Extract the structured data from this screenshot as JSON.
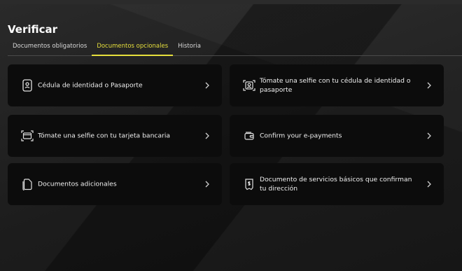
{
  "page": {
    "title": "Verificar"
  },
  "tabs": [
    {
      "label": "Documentos obligatorios",
      "active": false
    },
    {
      "label": "Documentos opcionales",
      "active": true
    },
    {
      "label": "Historia",
      "active": false
    }
  ],
  "cards": [
    {
      "label": "Cédula de identidad o Pasaporte",
      "icon": "id-card-icon"
    },
    {
      "label": "Tómate una selfie con tu cédula de identidad o pasaporte",
      "icon": "selfie-id-icon"
    },
    {
      "label": "Tómate una selfie con tu tarjeta bancaria",
      "icon": "selfie-card-icon"
    },
    {
      "label": "Confirm your e-payments",
      "icon": "wallet-icon"
    },
    {
      "label": "Documentos adicionales",
      "icon": "documents-icon"
    },
    {
      "label": "Documento de servicios básicos que confirman tu dirección",
      "icon": "utility-bill-icon"
    }
  ],
  "colors": {
    "accent": "#e6df3c",
    "card_bg": "#0c0c0c",
    "text": "#f0f0f0"
  }
}
